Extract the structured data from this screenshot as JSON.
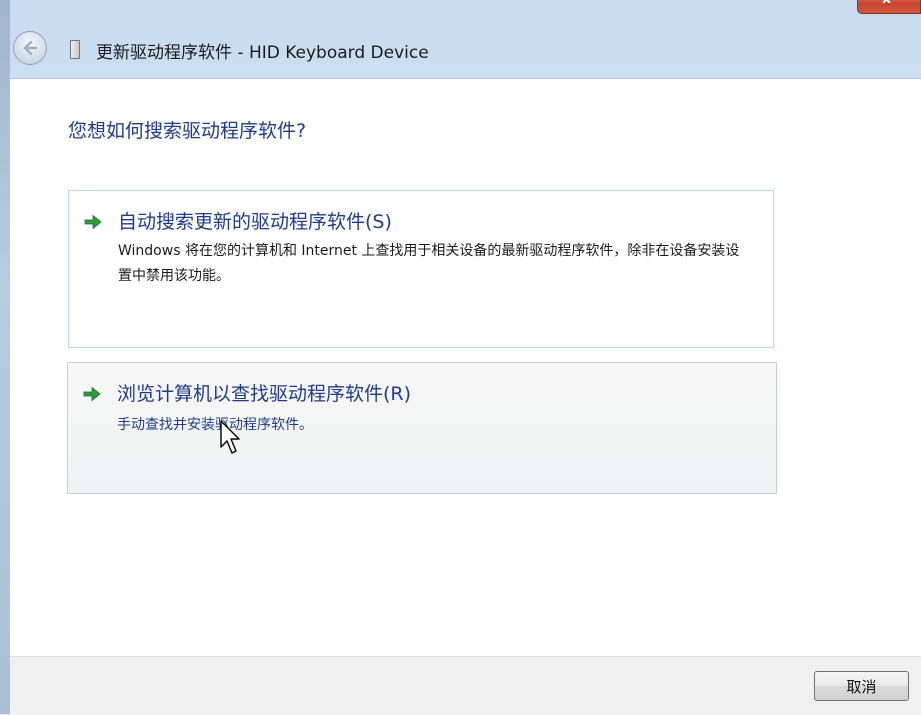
{
  "window": {
    "title": "更新驱动程序软件 - HID Keyboard Device",
    "close_glyph": "x"
  },
  "prompt": {
    "question": "您想如何搜索驱动程序软件?"
  },
  "options": [
    {
      "title": "自动搜索更新的驱动程序软件(S)",
      "description": "Windows 将在您的计算机和 Internet 上查找用于相关设备的最新驱动程序软件，除非在设备安装设置中禁用该功能。"
    },
    {
      "title": "浏览计算机以查找驱动程序软件(R)",
      "description": "手动查找并安装驱动程序软件。"
    }
  ],
  "footer": {
    "cancel_label": "取消"
  },
  "colors": {
    "link_blue": "#1e3c8c",
    "arrow_green": "#2e9a3c"
  },
  "icons": {
    "back": "back-arrow-icon",
    "device": "keyboard-device-icon",
    "option_arrow": "green-arrow-icon",
    "cursor": "mouse-pointer-icon"
  }
}
